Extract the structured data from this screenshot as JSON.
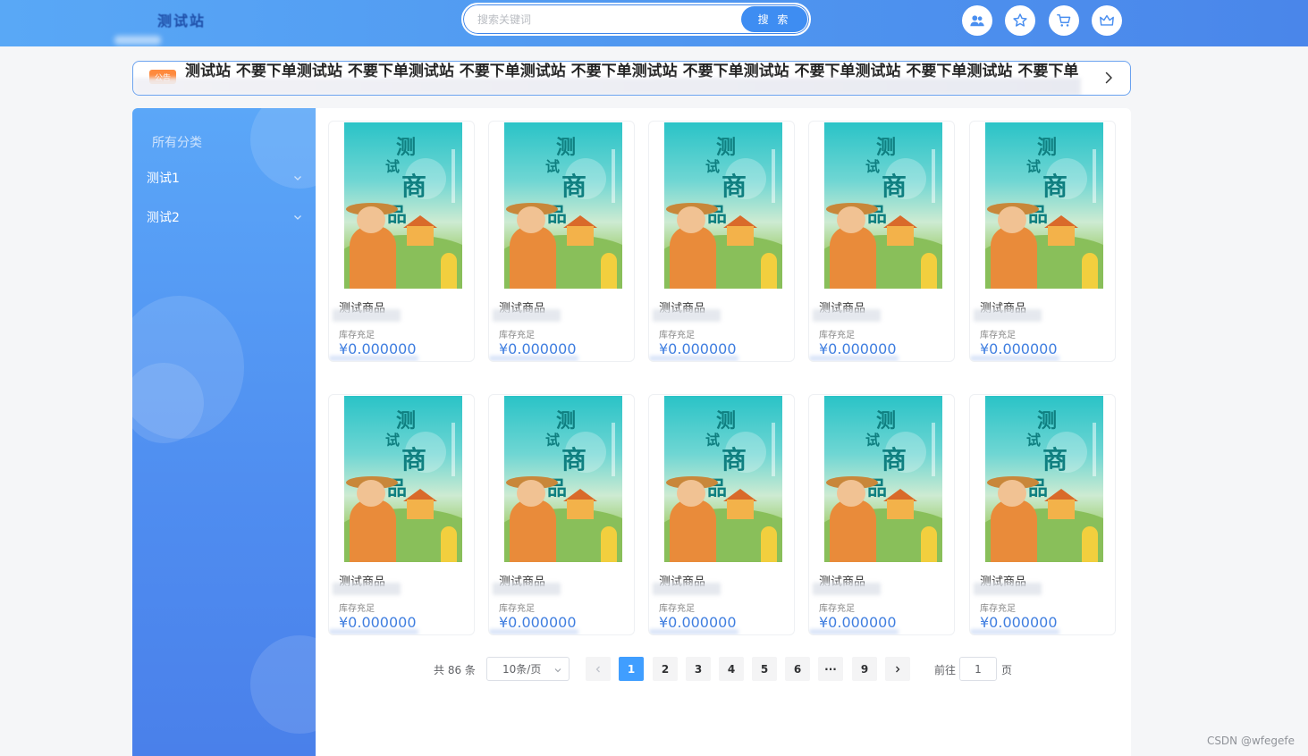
{
  "header": {
    "logo_text": "测试站",
    "search_placeholder": "搜索关键词",
    "search_button": "搜 索",
    "icons": [
      "user-group-icon",
      "star-icon",
      "cart-icon",
      "crown-icon"
    ]
  },
  "notice": {
    "tag": "公告",
    "text": "测试站 不要下单测试站 不要下单测试站 不要下单测试站 不要下单测试站 不要下单测试站 不要下单测试站 不要下单测试站 不要下单"
  },
  "sidebar": {
    "title": "所有分类",
    "items": [
      {
        "label": "测试1"
      },
      {
        "label": "测试2"
      }
    ]
  },
  "products": [
    {
      "name": "测试商品",
      "stock": "库存充足",
      "price": "¥0.000000"
    },
    {
      "name": "测试商品",
      "stock": "库存充足",
      "price": "¥0.000000"
    },
    {
      "name": "测试商品",
      "stock": "库存充足",
      "price": "¥0.000000"
    },
    {
      "name": "测试商品",
      "stock": "库存充足",
      "price": "¥0.000000"
    },
    {
      "name": "测试商品",
      "stock": "库存充足",
      "price": "¥0.000000"
    },
    {
      "name": "测试商品",
      "stock": "库存充足",
      "price": "¥0.000000"
    },
    {
      "name": "测试商品",
      "stock": "库存充足",
      "price": "¥0.000000"
    },
    {
      "name": "测试商品",
      "stock": "库存充足",
      "price": "¥0.000000"
    },
    {
      "name": "测试商品",
      "stock": "库存充足",
      "price": "¥0.000000"
    },
    {
      "name": "测试商品",
      "stock": "库存充足",
      "price": "¥0.000000"
    }
  ],
  "poster": {
    "line1": "测",
    "line2": "试",
    "line3": "商",
    "line4": "品"
  },
  "pagination": {
    "total_text": "共 86 条",
    "page_size": "10条/页",
    "pages": [
      "1",
      "2",
      "3",
      "4",
      "5",
      "6",
      "···",
      "9"
    ],
    "current_page": "1",
    "goto_label": "前往",
    "goto_value": "1",
    "goto_suffix": "页"
  },
  "watermark": "CSDN @wfegefe",
  "colors": {
    "accent": "#409eff",
    "header_start": "#59a8f6",
    "header_end": "#4a86ea",
    "price": "#3f7ee0",
    "notice_tag": "#ff8a3d"
  }
}
